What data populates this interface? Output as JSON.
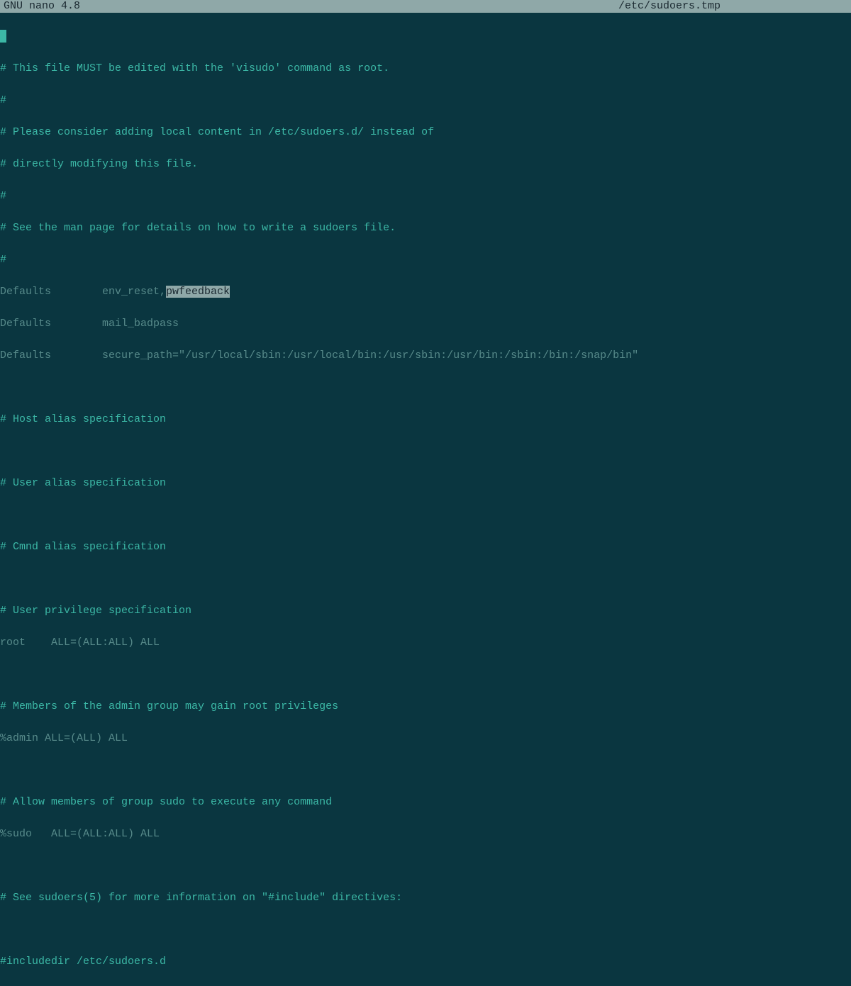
{
  "header": {
    "app_name": "GNU nano 4.8",
    "file_path": "/etc/sudoers.tmp"
  },
  "content": {
    "line0": "#",
    "line1": "# This file MUST be edited with the 'visudo' command as root.",
    "line2": "#",
    "line3": "# Please consider adding local content in /etc/sudoers.d/ instead of",
    "line4": "# directly modifying this file.",
    "line5": "#",
    "line6": "# See the man page for details on how to write a sudoers file.",
    "line7": "#",
    "line8_prefix": "Defaults        env_reset,",
    "line8_highlight": "pwfeedback",
    "line9": "Defaults        mail_badpass",
    "line10": "Defaults        secure_path=\"/usr/local/sbin:/usr/local/bin:/usr/sbin:/usr/bin:/sbin:/bin:/snap/bin\"",
    "line11": "",
    "line12": "# Host alias specification",
    "line13": "",
    "line14": "# User alias specification",
    "line15": "",
    "line16": "# Cmnd alias specification",
    "line17": "",
    "line18": "# User privilege specification",
    "line19": "root    ALL=(ALL:ALL) ALL",
    "line20": "",
    "line21": "# Members of the admin group may gain root privileges",
    "line22": "%admin ALL=(ALL) ALL",
    "line23": "",
    "line24": "# Allow members of group sudo to execute any command",
    "line25": "%sudo   ALL=(ALL:ALL) ALL",
    "line26": "",
    "line27": "# See sudoers(5) for more information on \"#include\" directives:",
    "line28": "",
    "line29": "#includedir /etc/sudoers.d"
  }
}
